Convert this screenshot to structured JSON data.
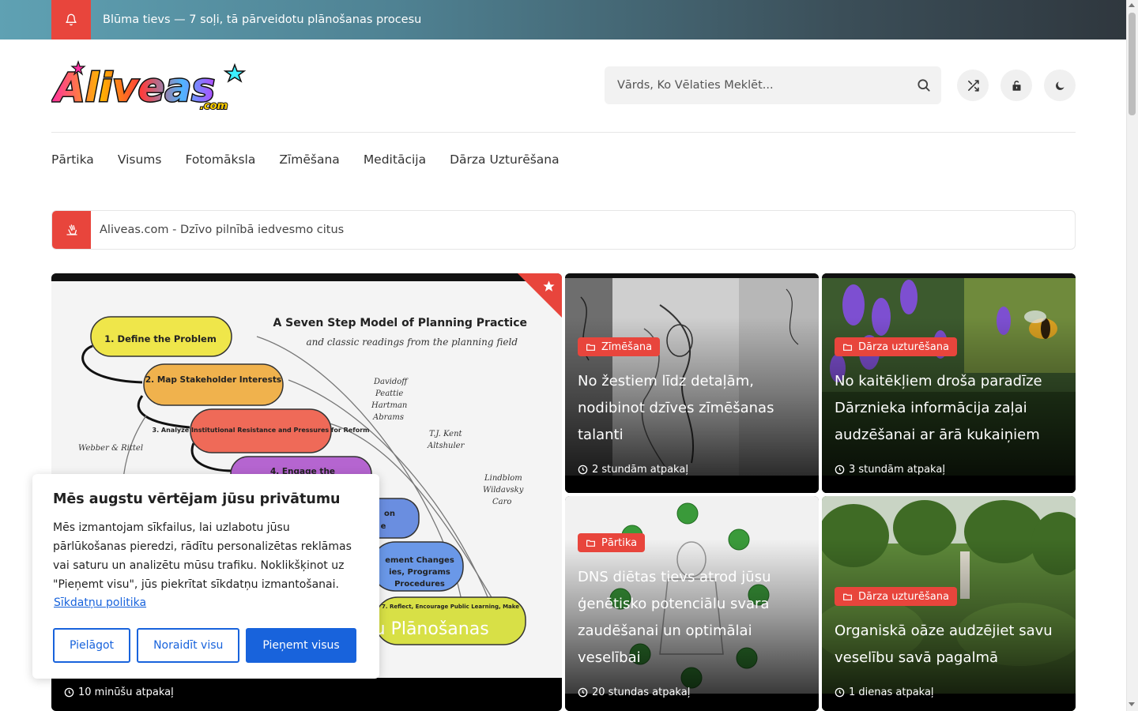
{
  "ticker": {
    "text": "Blūma tievs — 7 soļi, tā pārveidotu plānošanas procesu"
  },
  "logo": {
    "text": "Aliveas",
    "suffix": ".com"
  },
  "search": {
    "placeholder": "Vārds, Ko Vēlaties Meklēt..."
  },
  "header_icons": [
    "shuffle-icon",
    "lock-icon",
    "moon-icon"
  ],
  "nav": {
    "items": [
      "Pārtika",
      "Visums",
      "Fotomāksla",
      "Zīmēšana",
      "Meditācija",
      "Dārza Uzturēšana"
    ]
  },
  "notice": {
    "text": "Aliveas.com - Dzīvo pilnībā iedvesmo citus"
  },
  "featured": {
    "image": {
      "title": "A Seven Step Model of Planning Practice",
      "subtitle": "and classic readings from the planning field",
      "steps": [
        "1. Define the Problem",
        "2. Map Stakeholder Interests",
        "3. Analyze Institutional Resistance and Pressures for Reform",
        "4. Engage the",
        "on",
        "e",
        "ement Changes",
        "ies, Programs",
        "Procedures",
        "7. Reflect, Encourage Public Learning, Make"
      ],
      "names": [
        "Davidoff",
        "Peattie",
        "Hartman",
        "Abrams",
        "T.J. Kent",
        "Altshuler",
        "Webber & Rittel",
        "Lindblom",
        "Wildavsky",
        "Caro"
      ]
    },
    "title_visible": "tu Plānošanas",
    "time": "10 minūšu atpakaļ"
  },
  "cards": [
    {
      "category": "Zīmēšana",
      "title": "No žestiem līdz detaļām, nodibinot dzīves zīmēšanas talanti",
      "time": "2 stundām atpakaļ"
    },
    {
      "category": "Dārza uzturēšana",
      "title": "No kaitēkļiem droša paradīze Dārznieka informācija zaļai audzēšanai ar ārā kukaiņiem",
      "time": "3 stundām atpakaļ"
    },
    {
      "category": "Pārtika",
      "title": "DNS diētas tievs atrod jūsu ģenētisko potenciālu svara zaudēšanai un optimālai veselībai",
      "time": "20 stundas atpakaļ"
    },
    {
      "category": "Dārza uzturēšana",
      "title": "Organiskā oāze audzējiet savu veselību savā pagalmā",
      "time": "1 dienas atpakaļ"
    }
  ],
  "cookie": {
    "title": "Mēs augstu vērtējam jūsu privātumu",
    "text": "Mēs izmantojam sīkfailus, lai uzlabotu jūsu pārlūkošanas pieredzi, rādītu personalizētas reklāmas vai saturu un analizētu mūsu trafiku. Noklikšķinot uz \"Pieņemt visu\", jūs piekrītat sīkdatņu izmantošanai.",
    "link": "Sīkdatņu politika",
    "buttons": {
      "customize": "Pielāgot",
      "reject": "Noraidīt visu",
      "accept": "Pieņemt visus"
    }
  },
  "colors": {
    "accent": "#e8453c",
    "cookie_primary": "#1863dc"
  }
}
